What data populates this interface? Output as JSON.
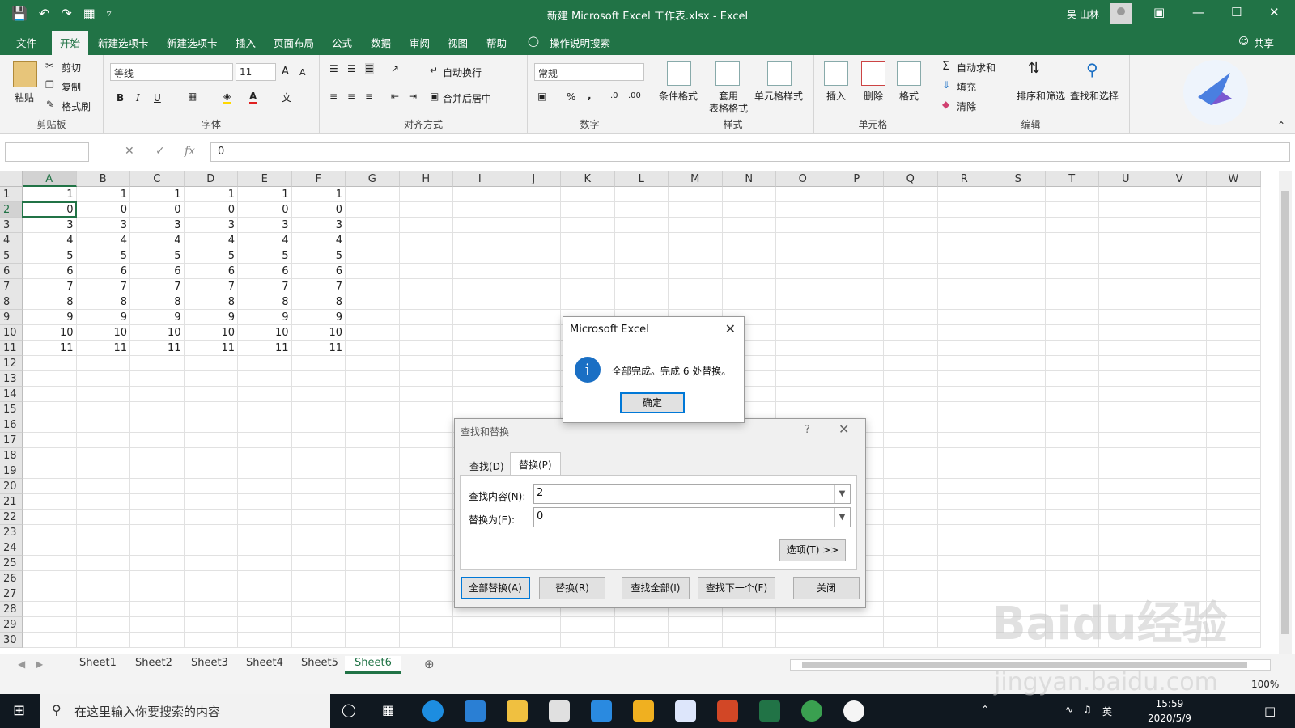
{
  "titlebar": {
    "title": "新建 Microsoft Excel 工作表.xlsx  -  Excel",
    "user": "吴 山林",
    "icons": [
      "save-icon",
      "undo-icon",
      "redo-icon",
      "form-icon",
      "customize-qat-icon"
    ]
  },
  "menu": {
    "tabs": [
      "文件",
      "开始",
      "新建选项卡",
      "新建选项卡",
      "插入",
      "页面布局",
      "公式",
      "数据",
      "审阅",
      "视图",
      "帮助"
    ],
    "active_tab": "开始",
    "tell_me": "操作说明搜索",
    "share": "共享"
  },
  "ribbon": {
    "clipboard": {
      "paste": "粘贴",
      "cut": "剪切",
      "copy": "复制",
      "format_painter": "格式刷",
      "label": "剪贴板"
    },
    "font": {
      "name": "等线",
      "size": "11",
      "label": "字体",
      "bold": "B",
      "italic": "I",
      "underline": "U",
      "grow": "A",
      "shrink": "A"
    },
    "alignment": {
      "wrap": "自动换行",
      "merge": "合并后居中",
      "label": "对齐方式"
    },
    "number": {
      "format": "常规",
      "label": "数字",
      "percent": "%",
      "comma": ","
    },
    "styles": {
      "conditional": "条件格式",
      "table_line1": "套用",
      "table_line2": "表格格式",
      "cell_styles": "单元格样式",
      "label": "样式"
    },
    "cells": {
      "insert": "插入",
      "delete": "删除",
      "format": "格式",
      "label": "单元格"
    },
    "editing": {
      "autosum": "自动求和",
      "fill": "填充",
      "clear": "清除",
      "sort": "排序和筛选",
      "find": "查找和选择",
      "label": "编辑"
    }
  },
  "formula_bar": {
    "name_box": "",
    "fx": "fx",
    "value": "0"
  },
  "grid": {
    "columns": [
      "A",
      "B",
      "C",
      "D",
      "E",
      "F",
      "G",
      "H",
      "I",
      "J",
      "K",
      "L",
      "M",
      "N",
      "O",
      "P",
      "Q",
      "R",
      "S",
      "T",
      "U",
      "V",
      "W"
    ],
    "rows": [
      "1",
      "2",
      "3",
      "4",
      "5",
      "6",
      "7",
      "8",
      "9",
      "10",
      "11",
      "12",
      "13",
      "14",
      "15",
      "16",
      "17",
      "18",
      "19",
      "20",
      "21",
      "22",
      "23",
      "24",
      "25",
      "26",
      "27",
      "28",
      "29",
      "30"
    ],
    "data": [
      [
        "1",
        "1",
        "1",
        "1",
        "1",
        "1"
      ],
      [
        "0",
        "0",
        "0",
        "0",
        "0",
        "0"
      ],
      [
        "3",
        "3",
        "3",
        "3",
        "3",
        "3"
      ],
      [
        "4",
        "4",
        "4",
        "4",
        "4",
        "4"
      ],
      [
        "5",
        "5",
        "5",
        "5",
        "5",
        "5"
      ],
      [
        "6",
        "6",
        "6",
        "6",
        "6",
        "6"
      ],
      [
        "7",
        "7",
        "7",
        "7",
        "7",
        "7"
      ],
      [
        "8",
        "8",
        "8",
        "8",
        "8",
        "8"
      ],
      [
        "9",
        "9",
        "9",
        "9",
        "9",
        "9"
      ],
      [
        "10",
        "10",
        "10",
        "10",
        "10",
        "10"
      ],
      [
        "11",
        "11",
        "11",
        "11",
        "11",
        "11"
      ]
    ],
    "active_cell": "A2"
  },
  "sheets": {
    "tabs": [
      "Sheet1",
      "Sheet2",
      "Sheet3",
      "Sheet4",
      "Sheet5",
      "Sheet6"
    ],
    "active": "Sheet6"
  },
  "status": {
    "zoom": "100%"
  },
  "message_box": {
    "title": "Microsoft Excel",
    "text": "全部完成。完成 6 处替换。",
    "ok": "确定",
    "icon": "i"
  },
  "find_replace": {
    "title": "查找和替换",
    "help": "?",
    "tabs": [
      "查找(D)",
      "替换(P)"
    ],
    "active_tab": "替换(P)",
    "find_label": "查找内容(N):",
    "find_value": "2",
    "replace_label": "替换为(E):",
    "replace_value": "0",
    "options": "选项(T) >>",
    "buttons": [
      "全部替换(A)",
      "替换(R)",
      "查找全部(I)",
      "查找下一个(F)",
      "关闭"
    ]
  },
  "taskbar": {
    "search_placeholder": "在这里输入你要搜索的内容",
    "time": "15:59",
    "date": "2020/5/9",
    "ime": "英"
  },
  "watermark": {
    "text": "Baidu经验",
    "sub": "jingyan.baidu.com"
  },
  "colors": {
    "excel_green": "#217346",
    "accent_blue": "#0078d7"
  }
}
